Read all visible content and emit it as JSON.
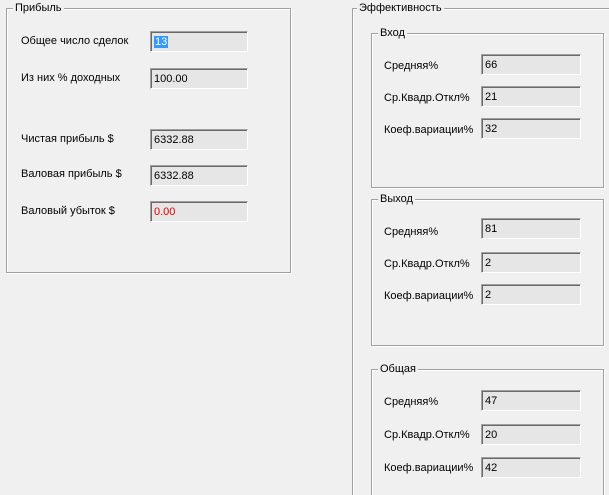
{
  "profit": {
    "title": "Прибыль",
    "total_trades_label": "Общее число сделок",
    "total_trades_value": "13",
    "profitable_pct_label": "Из них % доходных",
    "profitable_pct_value": "100.00",
    "net_profit_label": "Чистая прибыль $",
    "net_profit_value": "6332.88",
    "gross_profit_label": "Валовая прибыль $",
    "gross_profit_value": "6332.88",
    "gross_loss_label": "Валовый убыток $",
    "gross_loss_value": "0.00"
  },
  "efficiency": {
    "title": "Эффективность",
    "entry": {
      "title": "Вход",
      "mean_label": "Средняя%",
      "mean_value": "66",
      "stddev_label": "Ср.Квадр.Откл%",
      "stddev_value": "21",
      "cv_label": "Коеф.вариации%",
      "cv_value": "32"
    },
    "exit": {
      "title": "Выход",
      "mean_label": "Средняя%",
      "mean_value": "81",
      "stddev_label": "Ср.Квадр.Откл%",
      "stddev_value": "2",
      "cv_label": "Коеф.вариации%",
      "cv_value": "2"
    },
    "total": {
      "title": "Общая",
      "mean_label": "Средняя%",
      "mean_value": "47",
      "stddev_label": "Ср.Квадр.Откл%",
      "stddev_value": "20",
      "cv_label": "Коеф.вариации%",
      "cv_value": "42"
    }
  },
  "colors": {
    "window_bg": "#f0f0f0",
    "field_bg": "#e6e6e6",
    "selection": "#3399ff",
    "negative_text": "#e00000"
  }
}
